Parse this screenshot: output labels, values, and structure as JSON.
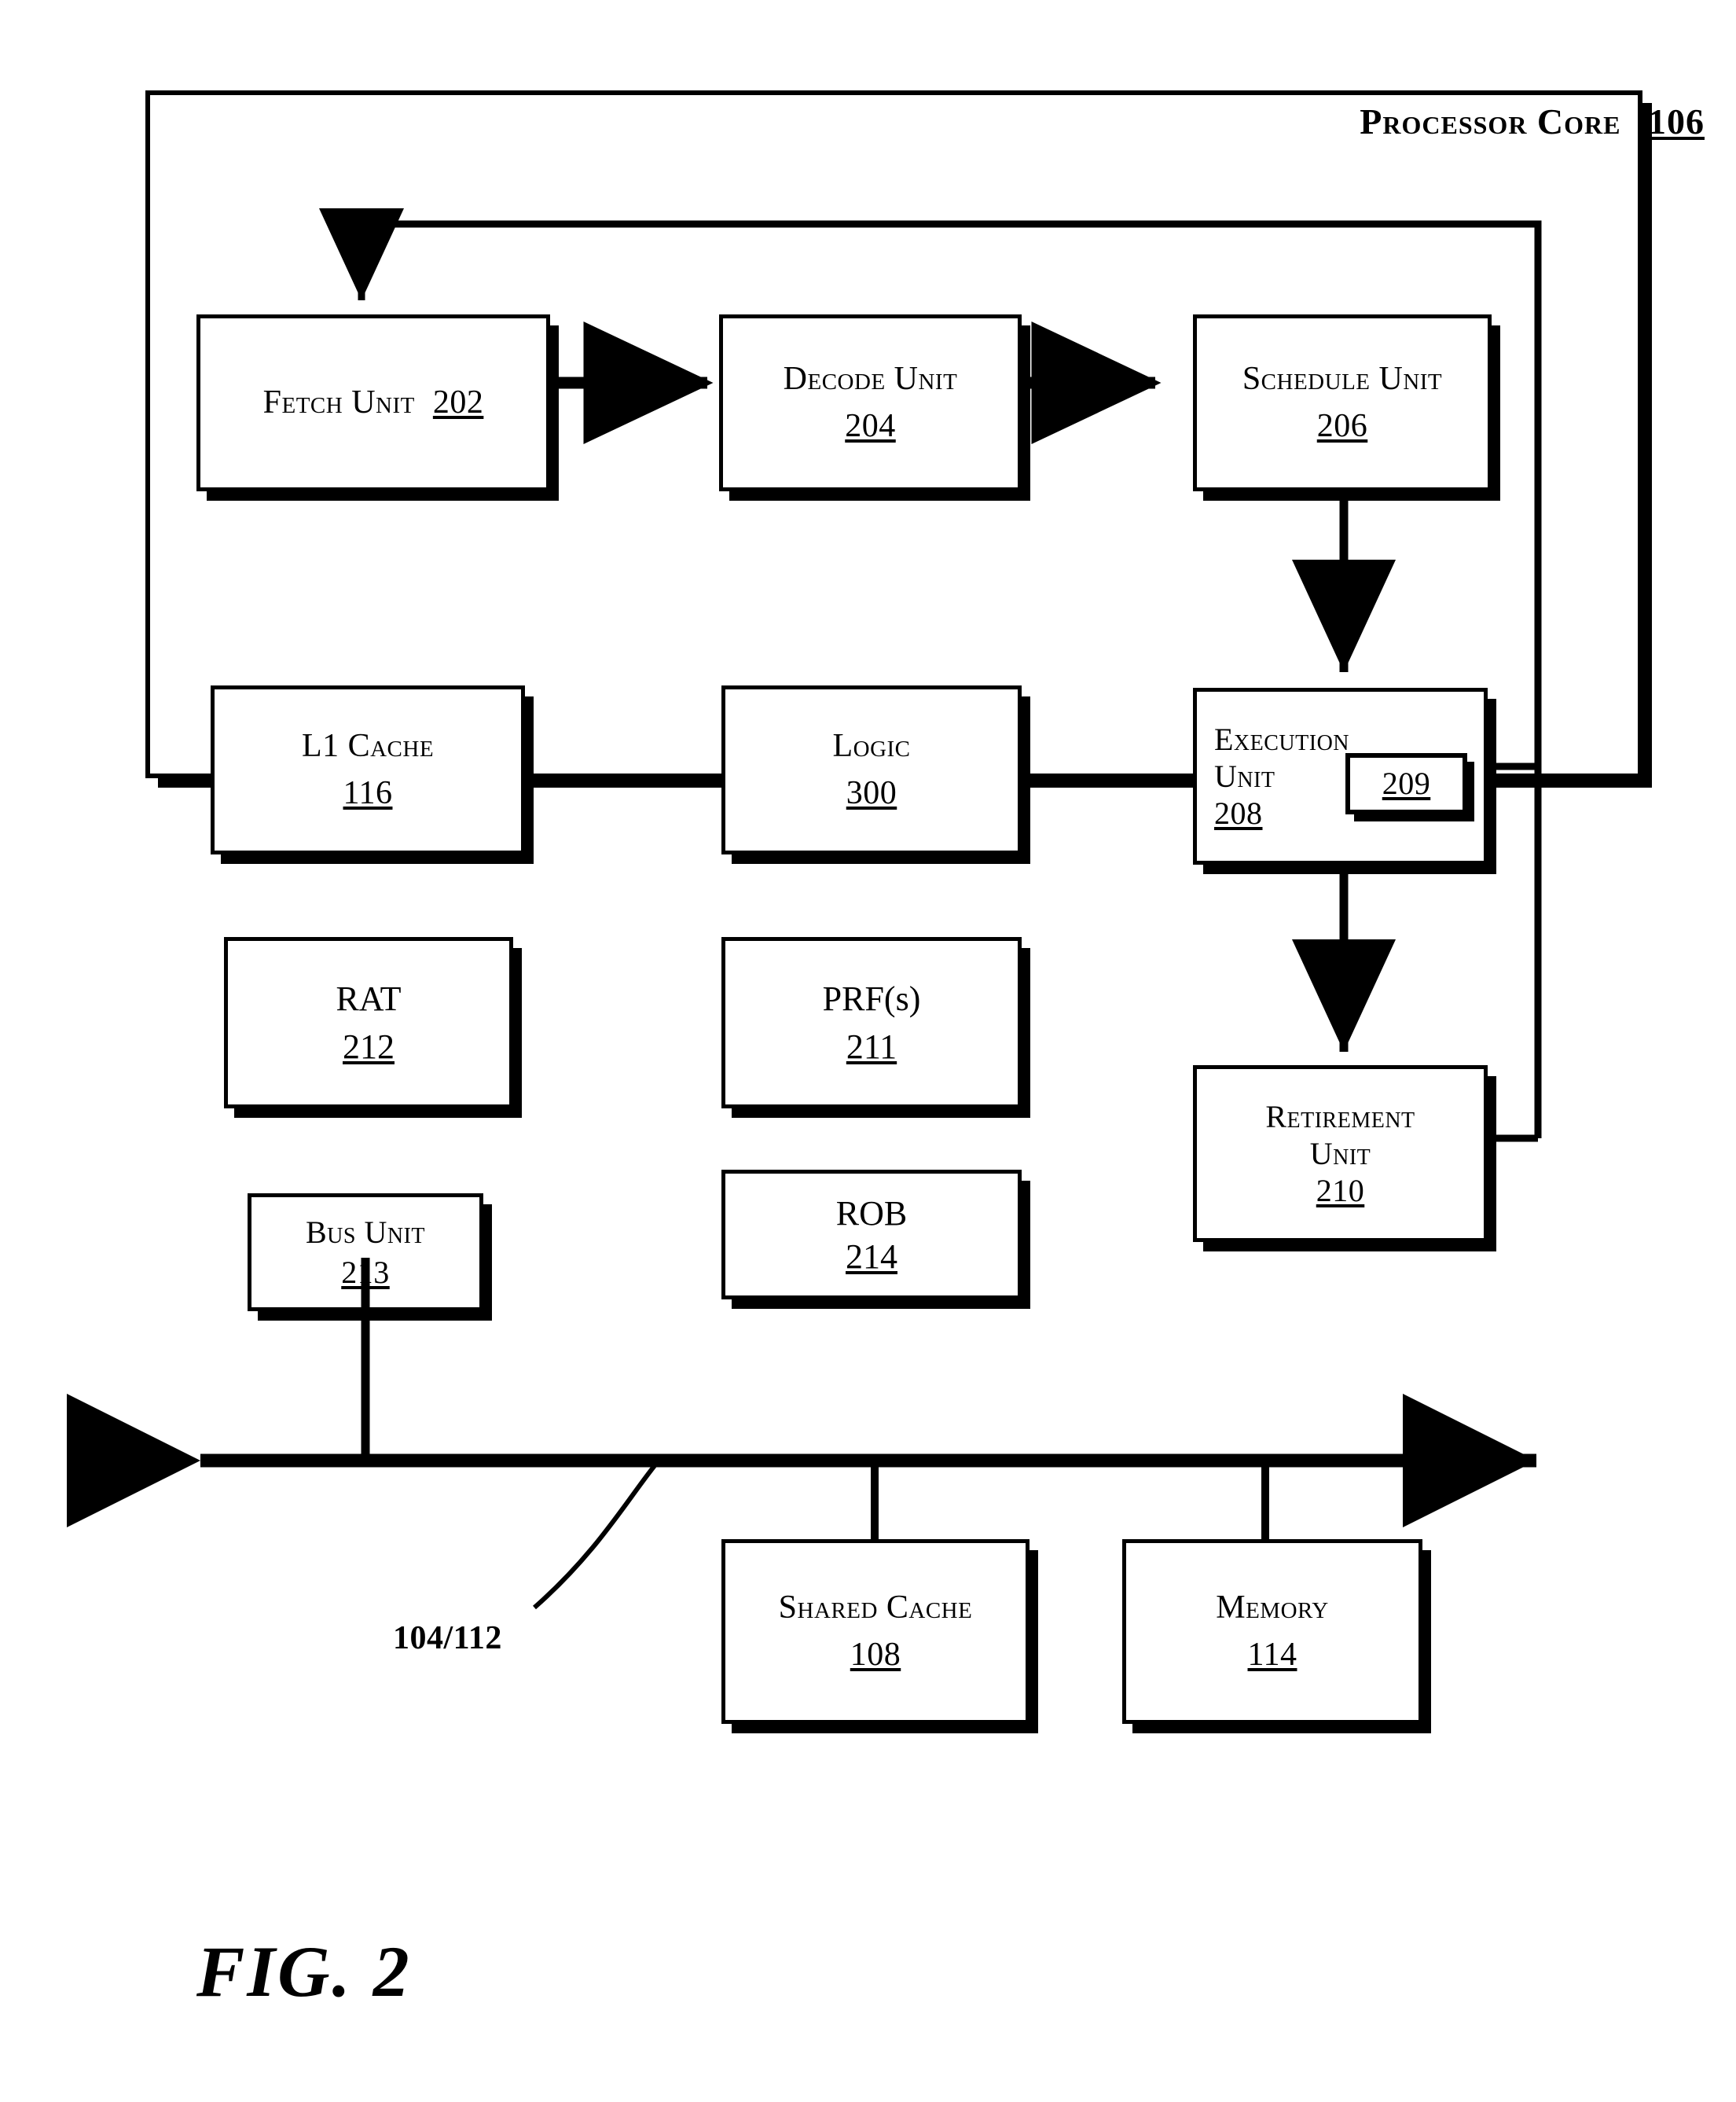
{
  "figure": {
    "caption": "FIG. 2",
    "core_title": "Processor Core",
    "core_ref": "106"
  },
  "blocks": [
    {
      "id": "fetch-unit",
      "label": "Fetch Unit",
      "ref": "202",
      "inline_ref": true
    },
    {
      "id": "decode-unit",
      "label": "Decode Unit",
      "ref": "204",
      "inline_ref": false
    },
    {
      "id": "schedule-unit",
      "label": "Schedule Unit",
      "ref": "206",
      "inline_ref": false
    },
    {
      "id": "l1-cache",
      "label": "L1 Cache",
      "ref": "116",
      "inline_ref": false
    },
    {
      "id": "logic",
      "label": "Logic",
      "ref": "300",
      "inline_ref": false
    },
    {
      "id": "execution-unit",
      "label": "Execution Unit",
      "ref": "208",
      "inline_ref": false
    },
    {
      "id": "execution-sub",
      "label": "",
      "ref": "209",
      "inline_ref": false
    },
    {
      "id": "rat",
      "label": "RAT",
      "ref": "212",
      "inline_ref": false
    },
    {
      "id": "prf",
      "label": "PRF(s)",
      "ref": "211",
      "inline_ref": false
    },
    {
      "id": "retirement-unit",
      "label": "Retirement Unit",
      "ref": "210",
      "inline_ref": false
    },
    {
      "id": "bus-unit",
      "label": "Bus Unit",
      "ref": "213",
      "inline_ref": false
    },
    {
      "id": "rob",
      "label": "ROB",
      "ref": "214",
      "inline_ref": false
    },
    {
      "id": "shared-cache",
      "label": "Shared Cache",
      "ref": "108",
      "inline_ref": false
    },
    {
      "id": "memory",
      "label": "Memory",
      "ref": "114",
      "inline_ref": false
    }
  ],
  "labels": {
    "bus_ref": "104/112"
  },
  "text": {
    "fetch_line1": "Fetch Unit 202",
    "decode_line1": "Decode Unit",
    "decode_ref": "204",
    "schedule_line1": "Schedule Unit",
    "schedule_ref": "206",
    "l1_line1": "L1 Cache",
    "l1_ref": "116",
    "logic_line1": "Logic",
    "logic_ref": "300",
    "exec_line1": "Execution",
    "exec_line2": "Unit",
    "exec_ref": "208",
    "exec_sub_ref": "209",
    "rat_line1": "RAT",
    "rat_ref": "212",
    "prf_line1": "PRF(s)",
    "prf_ref": "211",
    "retire_line1": "Retirement",
    "retire_line2": "Unit",
    "retire_ref": "210",
    "bus_unit_line1": "Bus Unit",
    "bus_unit_ref": "213",
    "rob_line1": "ROB",
    "rob_ref": "214",
    "shared_line1": "Shared Cache",
    "shared_ref": "108",
    "memory_line1": "Memory",
    "memory_ref": "114"
  },
  "colors": {
    "ink": "#000000",
    "paper": "#ffffff"
  }
}
